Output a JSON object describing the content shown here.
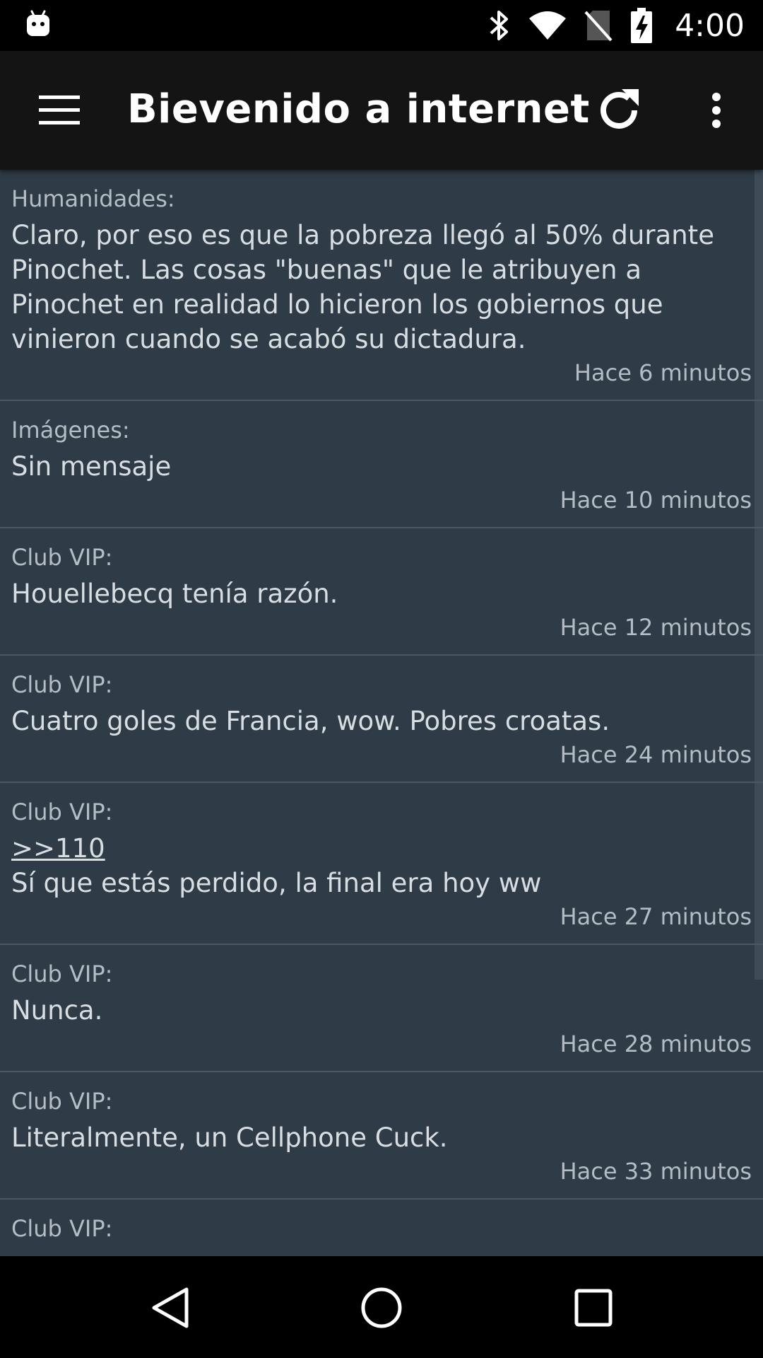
{
  "status_bar": {
    "time": "4:00",
    "icons": [
      "android-icon",
      "bluetooth-icon",
      "wifi-icon",
      "no-sim-icon",
      "battery-charging-icon"
    ]
  },
  "app_bar": {
    "title": "Bievenido a internet",
    "icons": [
      "menu-icon",
      "refresh-icon",
      "more-vert-icon"
    ]
  },
  "posts": [
    {
      "board": "Humanidades:",
      "message": "Claro, por eso es que la pobreza llegó al 50% durante Pinochet. Las cosas \"buenas\" que le atribuyen a Pinochet en realidad lo hicieron los gobiernos que vinieron cuando se acabó su dictadura.",
      "time": "Hace 6 minutos"
    },
    {
      "board": "Imágenes:",
      "message": "Sin mensaje",
      "time": "Hace 10 minutos"
    },
    {
      "board": "Club VIP:",
      "message": "Houellebecq tenía razón.",
      "time": "Hace 12 minutos"
    },
    {
      "board": "Club VIP:",
      "message": "Cuatro goles de Francia, wow. Pobres croatas.",
      "time": "Hace 24 minutos"
    },
    {
      "board": "Club VIP:",
      "reply_link": ">>110",
      "message": "Sí que estás perdido, la final era hoy ww",
      "time": "Hace 27 minutos"
    },
    {
      "board": "Club VIP:",
      "message": "Nunca.",
      "time": "Hace 28 minutos"
    },
    {
      "board": "Club VIP:",
      "message": "Literalmente, un Cellphone Cuck.",
      "time": "Hace 33 minutos"
    },
    {
      "board": "Club VIP:"
    }
  ],
  "nav_bar": {
    "icons": [
      "back-icon",
      "home-icon",
      "recents-icon"
    ]
  },
  "colors": {
    "status_bar": "#000000",
    "app_bar": "#141414",
    "feed_background": "#2f3b46",
    "divider": "#4b5762",
    "primary_text": "#d8dde2",
    "secondary_text": "#b4bcc4"
  }
}
